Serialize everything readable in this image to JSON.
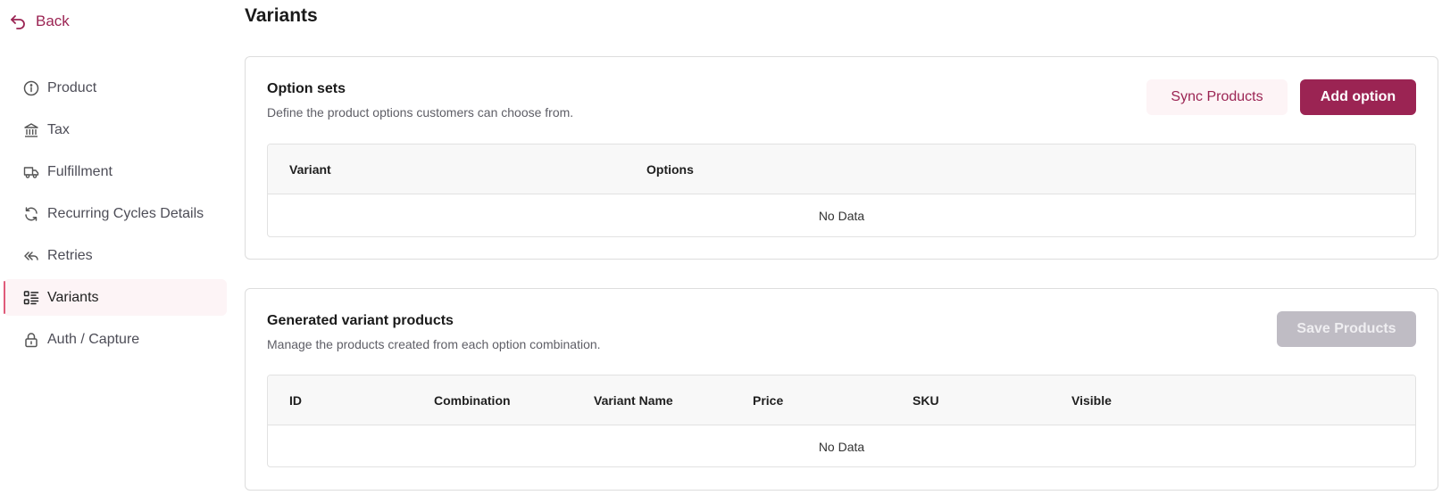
{
  "back_label": "Back",
  "page_title": "Variants",
  "sidebar": {
    "items": [
      {
        "label": "Product",
        "icon": "info-circle-icon"
      },
      {
        "label": "Tax",
        "icon": "bank-icon"
      },
      {
        "label": "Fulfillment",
        "icon": "truck-icon"
      },
      {
        "label": "Recurring Cycles Details",
        "icon": "refresh-icon"
      },
      {
        "label": "Retries",
        "icon": "reply-all-icon"
      },
      {
        "label": "Variants",
        "icon": "list-checks-icon",
        "active": true
      },
      {
        "label": "Auth / Capture",
        "icon": "lock-icon"
      }
    ]
  },
  "option_sets": {
    "title": "Option sets",
    "subtitle": "Define the product options customers can choose from.",
    "sync_label": "Sync Products",
    "add_label": "Add option",
    "columns": [
      "Variant",
      "Options"
    ],
    "empty_text": "No Data"
  },
  "generated": {
    "title": "Generated variant products",
    "subtitle": "Manage the products created from each option combination.",
    "save_label": "Save Products",
    "columns": [
      "ID",
      "Combination",
      "Variant Name",
      "Price",
      "SKU",
      "Visible"
    ],
    "empty_text": "No Data"
  },
  "colors": {
    "accent": "#9b2453",
    "active_bg": "#fdf4f6",
    "disabled_btn": "#bfbcc4"
  }
}
